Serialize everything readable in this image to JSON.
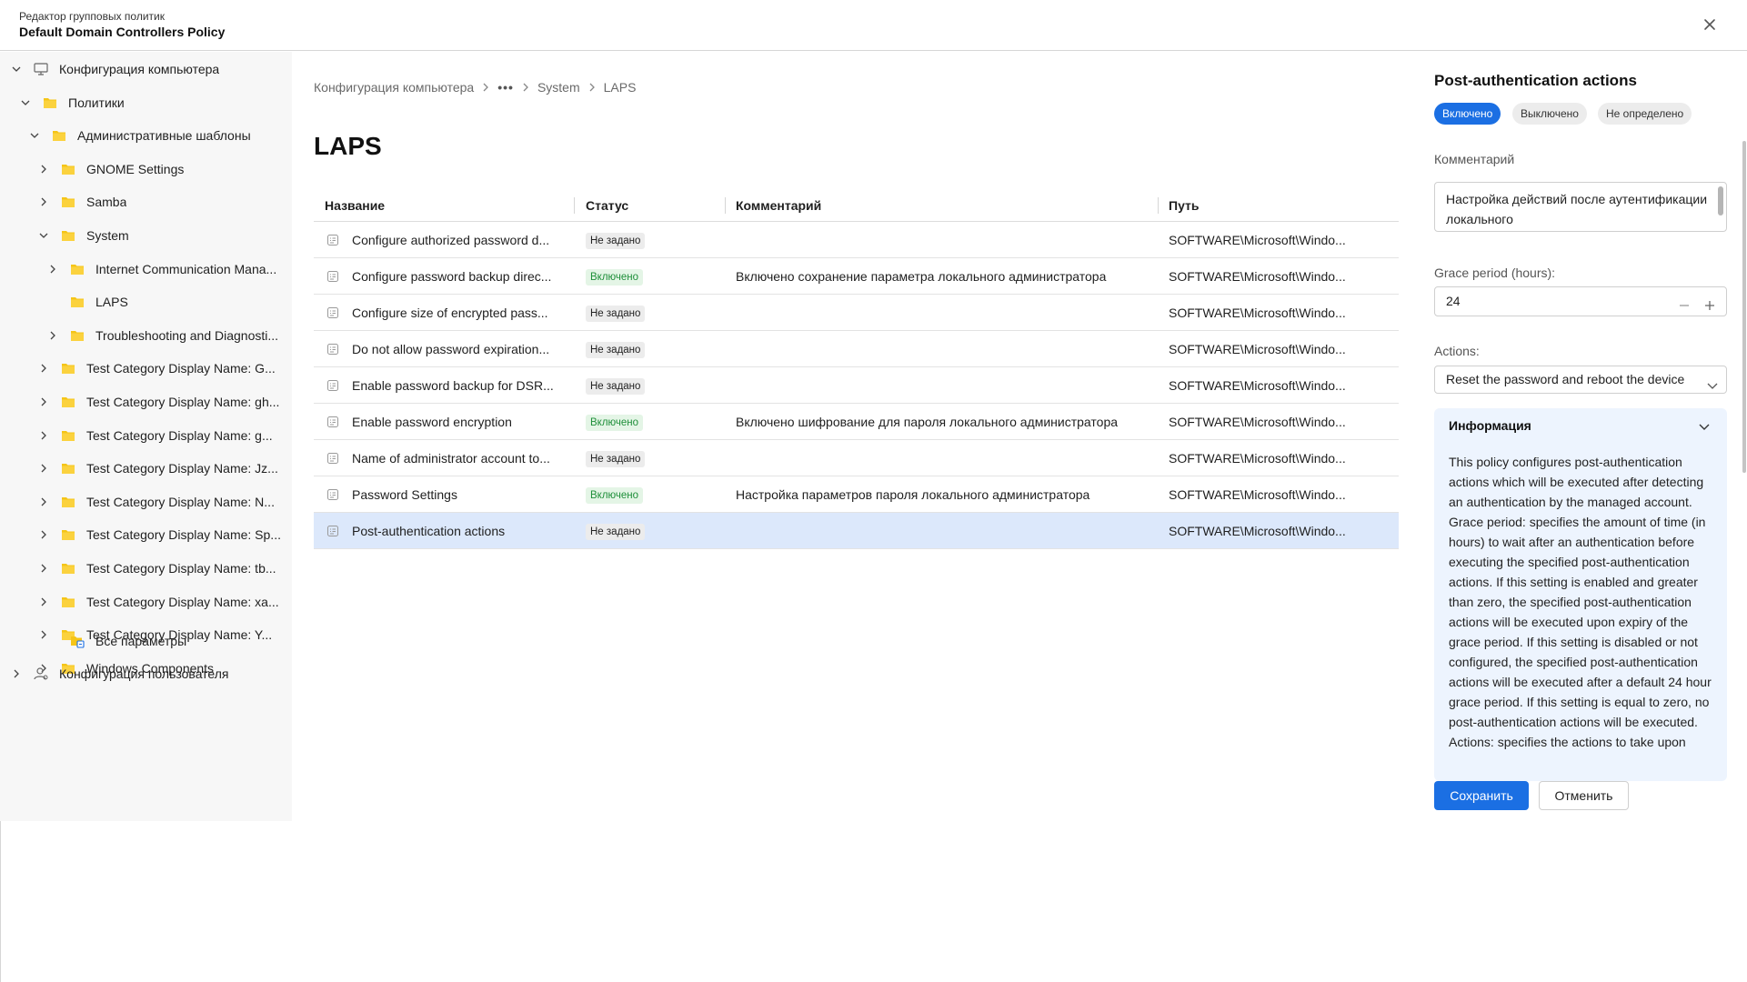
{
  "header": {
    "subtitle": "Редактор групповых политик",
    "title": "Default Domain Controllers Policy"
  },
  "sidebar": {
    "items": [
      {
        "label": "Конфигурация компьютера",
        "icon": "computer-icon",
        "chevron": "down"
      },
      {
        "label": "Политики",
        "icon": "folder-icon",
        "chevron": "down"
      },
      {
        "label": "Административные шаблоны",
        "icon": "folder-icon",
        "chevron": "down"
      },
      {
        "label": "GNOME Settings",
        "icon": "folder-icon",
        "chevron": "right"
      },
      {
        "label": "Samba",
        "icon": "folder-icon",
        "chevron": "right"
      },
      {
        "label": "System",
        "icon": "folder-icon",
        "chevron": "down"
      },
      {
        "label": "Internet Communication Mana...",
        "icon": "folder-icon",
        "chevron": "right"
      },
      {
        "label": "LAPS",
        "icon": "folder-icon",
        "chevron": "none"
      },
      {
        "label": "Troubleshooting and Diagnosti...",
        "icon": "folder-icon",
        "chevron": "right"
      },
      {
        "label": "Test Category Display Name: G...",
        "icon": "folder-icon",
        "chevron": "right"
      },
      {
        "label": "Test Category Display Name: gh...",
        "icon": "folder-icon",
        "chevron": "right"
      },
      {
        "label": "Test Category Display Name: g...",
        "icon": "folder-icon",
        "chevron": "right"
      },
      {
        "label": "Test Category Display Name: Jz...",
        "icon": "folder-icon",
        "chevron": "right"
      },
      {
        "label": "Test Category Display Name: N...",
        "icon": "folder-icon",
        "chevron": "right"
      },
      {
        "label": "Test Category Display Name: Sp...",
        "icon": "folder-icon",
        "chevron": "right"
      },
      {
        "label": "Test Category Display Name: tb...",
        "icon": "folder-icon",
        "chevron": "right"
      },
      {
        "label": "Test Category Display Name: xa...",
        "icon": "folder-icon",
        "chevron": "right"
      },
      {
        "label": "Test Category Display Name: Y...",
        "icon": "folder-icon",
        "chevron": "right"
      },
      {
        "label": "Windows Components",
        "icon": "folder-icon",
        "chevron": "right"
      },
      {
        "label": "Все параметры",
        "icon": "all-settings-icon",
        "chevron": "none"
      },
      {
        "label": "Конфигурация пользователя",
        "icon": "user-config-icon",
        "chevron": "right"
      }
    ]
  },
  "breadcrumb": {
    "root": "Конфигурация компьютера",
    "more": "•••",
    "items": [
      "System",
      "LAPS"
    ]
  },
  "main": {
    "title": "LAPS",
    "columns": [
      "Название",
      "Статус",
      "Комментарий",
      "Путь"
    ],
    "rows": [
      {
        "name": "Configure authorized password d...",
        "status": "Не задано",
        "status_kind": "notset",
        "comment": "",
        "path": "SOFTWARE\\Microsoft\\Windo..."
      },
      {
        "name": "Configure password backup direc...",
        "status": "Включено",
        "status_kind": "on",
        "comment": "Включено сохранение параметра локального администратора",
        "path": "SOFTWARE\\Microsoft\\Windo..."
      },
      {
        "name": "Configure size of encrypted pass...",
        "status": "Не задано",
        "status_kind": "notset",
        "comment": "",
        "path": "SOFTWARE\\Microsoft\\Windo..."
      },
      {
        "name": "Do not allow password expiration...",
        "status": "Не задано",
        "status_kind": "notset",
        "comment": "",
        "path": "SOFTWARE\\Microsoft\\Windo..."
      },
      {
        "name": "Enable password backup for DSR...",
        "status": "Не задано",
        "status_kind": "notset",
        "comment": "",
        "path": "SOFTWARE\\Microsoft\\Windo..."
      },
      {
        "name": "Enable password encryption",
        "status": "Включено",
        "status_kind": "on",
        "comment": "Включено шифрование для пароля локального администратора",
        "path": "SOFTWARE\\Microsoft\\Windo..."
      },
      {
        "name": "Name of administrator account to...",
        "status": "Не задано",
        "status_kind": "notset",
        "comment": "",
        "path": "SOFTWARE\\Microsoft\\Windo..."
      },
      {
        "name": "Password Settings",
        "status": "Включено",
        "status_kind": "on",
        "comment": "Настройка параметров пароля локального администратора",
        "path": "SOFTWARE\\Microsoft\\Windo..."
      },
      {
        "name": "Post-authentication actions",
        "status": "Не задано",
        "status_kind": "notset",
        "comment": "",
        "path": "SOFTWARE\\Microsoft\\Windo...",
        "selected": true
      }
    ]
  },
  "panel": {
    "title": "Post-authentication actions",
    "states": [
      "Включено",
      "Выключено",
      "Не определено"
    ],
    "active_state": "Включено",
    "comment_label": "Комментарий",
    "comment_value": "Настройка действий после аутентификации локального",
    "grace_label": "Grace period (hours):",
    "grace_value": "24",
    "actions_label": "Actions:",
    "actions_value": "Reset the password and reboot the device",
    "info_title": "Информация",
    "info_text": "This policy configures post-authentication actions which will be executed after detecting an authentication by the managed account. Grace period: specifies the amount of time (in hours) to wait after an authentication before executing the specified post-authentication actions. If this setting is enabled and greater than zero, the specified post-authentication actions will be executed upon expiry of the grace period. If this setting is disabled or not configured, the specified post-authentication actions will be executed after a default 24 hour grace period. If this setting is equal to zero, no post-authentication actions will be executed. Actions: specifies the actions to take upon",
    "save_label": "Сохранить",
    "cancel_label": "Отменить"
  },
  "colors": {
    "accent": "#1b6fe3",
    "selected_row": "#dce8fb",
    "folder": "#f5c518",
    "enabled_text": "#1f8f3a",
    "info_bg": "#edf4fe"
  }
}
